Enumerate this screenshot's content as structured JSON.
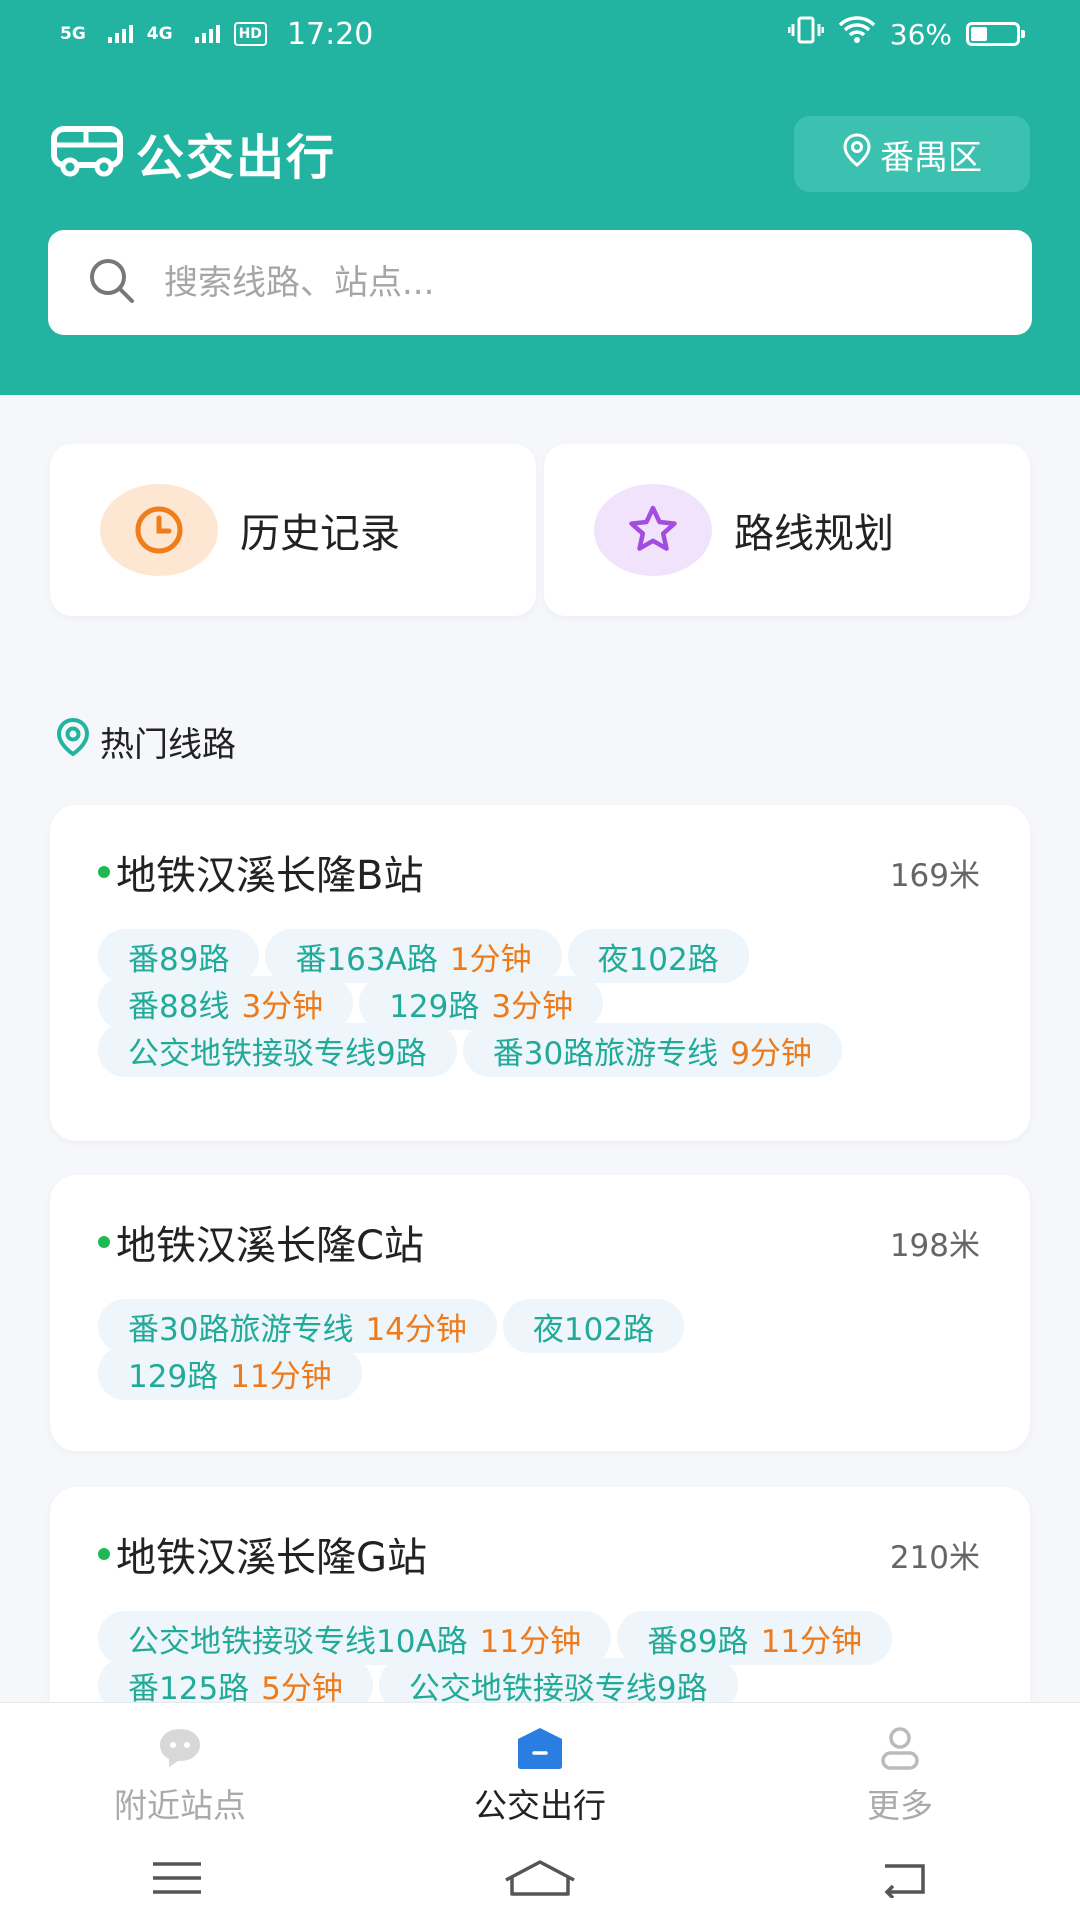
{
  "status_bar": {
    "network1": "5G",
    "network2": "4G",
    "hd": "HD",
    "time": "17:20",
    "battery": "36%",
    "battery_level": 0.36
  },
  "header": {
    "title": "公交出行",
    "district": "番禺区",
    "search_placeholder": "搜索线路、站点..."
  },
  "quick_actions": [
    {
      "label": "历史记录",
      "icon": "clock-icon"
    },
    {
      "label": "路线规划",
      "icon": "star-icon"
    }
  ],
  "section": {
    "title": "热门线路"
  },
  "stations": [
    {
      "name": "地铁汉溪长隆B站",
      "distance": "169米",
      "rows": [
        [
          {
            "line": "番89路",
            "eta": ""
          },
          {
            "line": "番163A路",
            "eta": "1分钟"
          },
          {
            "line": "夜102路",
            "eta": ""
          }
        ],
        [
          {
            "line": "番88线",
            "eta": "3分钟"
          },
          {
            "line": "129路",
            "eta": "3分钟"
          }
        ],
        [
          {
            "line": "公交地铁接驳专线9路",
            "eta": ""
          },
          {
            "line": "番30路旅游专线",
            "eta": "9分钟"
          }
        ]
      ]
    },
    {
      "name": "地铁汉溪长隆C站",
      "distance": "198米",
      "rows": [
        [
          {
            "line": "番30路旅游专线",
            "eta": "14分钟"
          },
          {
            "line": "夜102路",
            "eta": ""
          }
        ],
        [
          {
            "line": "129路",
            "eta": "11分钟"
          }
        ]
      ]
    },
    {
      "name": "地铁汉溪长隆G站",
      "distance": "210米",
      "rows": [
        [
          {
            "line": "公交地铁接驳专线10A路",
            "eta": "11分钟"
          },
          {
            "line": "番89路",
            "eta": "11分钟"
          }
        ],
        [
          {
            "line": "番125路",
            "eta": "5分钟"
          },
          {
            "line": "公交地铁接驳专线9路",
            "eta": ""
          }
        ]
      ]
    }
  ],
  "tabbar": [
    {
      "label": "附近站点",
      "icon": "chat-bubble-icon",
      "active": false
    },
    {
      "label": "公交出行",
      "icon": "home-icon",
      "active": true
    },
    {
      "label": "更多",
      "icon": "user-icon",
      "active": false
    }
  ],
  "colors": {
    "primary": "#22b3a1",
    "eta": "#ee7a1a",
    "line": "#22aa98"
  }
}
